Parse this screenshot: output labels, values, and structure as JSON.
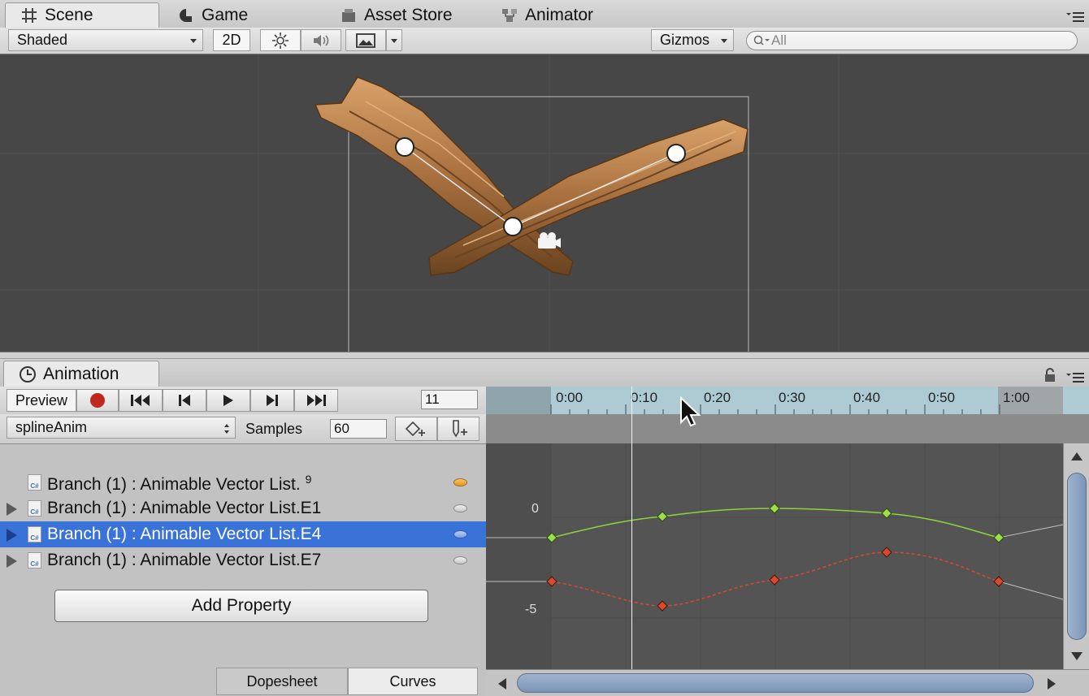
{
  "tabs": {
    "scene": "Scene",
    "game": "Game",
    "asset_store": "Asset Store",
    "animator": "Animator"
  },
  "scene_toolbar": {
    "shading_mode": "Shaded",
    "mode_2d": "2D",
    "gizmos_label": "Gizmos",
    "search_placeholder": "All"
  },
  "animation": {
    "tab_title": "Animation",
    "preview_label": "Preview",
    "frame_value": "11",
    "clip_name": "splineAnim",
    "samples_label": "Samples",
    "samples_value": "60",
    "properties": [
      {
        "label": "Branch (1) : Animable Vector List.",
        "superscript": "9",
        "expandable": false,
        "selected": false
      },
      {
        "label": "Branch (1) : Animable Vector List.E1",
        "superscript": "",
        "expandable": true,
        "selected": false
      },
      {
        "label": "Branch (1) : Animable Vector List.E4",
        "superscript": "",
        "expandable": true,
        "selected": true
      },
      {
        "label": "Branch (1) : Animable Vector List.E7",
        "superscript": "",
        "expandable": true,
        "selected": false
      }
    ],
    "add_property_label": "Add Property",
    "view_tabs": {
      "dopesheet": "Dopesheet",
      "curves": "Curves"
    },
    "timeline_ticks": [
      "0:00",
      "0:10",
      "0:20",
      "0:30",
      "0:40",
      "0:50",
      "1:00"
    ],
    "y_axis_labels": [
      "0",
      "-5"
    ],
    "colors": {
      "selection": "#3a73d8",
      "curve_green": "#8ad43a",
      "curve_red": "#d84a2c",
      "record": "#c0281e",
      "timeline": "#aecbd4"
    }
  }
}
